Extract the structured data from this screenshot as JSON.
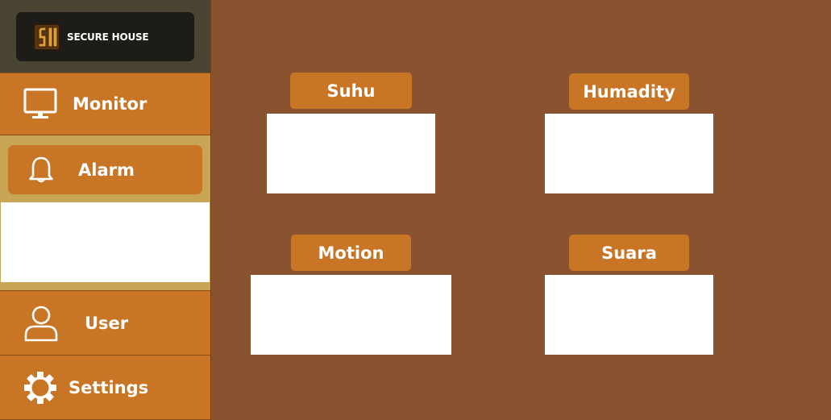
{
  "brand": {
    "name": "SECURE HOUSE"
  },
  "sidebar": {
    "items": [
      {
        "id": "monitor",
        "label": "Monitor",
        "icon": "monitor-icon"
      },
      {
        "id": "alarm",
        "label": "Alarm",
        "icon": "bell-icon"
      },
      {
        "id": "user",
        "label": "User",
        "icon": "user-icon"
      },
      {
        "id": "settings",
        "label": "Settings",
        "icon": "gear-icon"
      }
    ]
  },
  "cards": [
    {
      "label": "Suhu",
      "value": ""
    },
    {
      "label": "Humadity",
      "value": ""
    },
    {
      "label": "Motion",
      "value": ""
    },
    {
      "label": "Suara",
      "value": ""
    }
  ],
  "colors": {
    "background": "#8a5330",
    "accent": "#c87526",
    "sidebar_active_bg": "#c8a555",
    "brand_bar": "#4a4533",
    "brand_pill": "#1d1c18"
  }
}
